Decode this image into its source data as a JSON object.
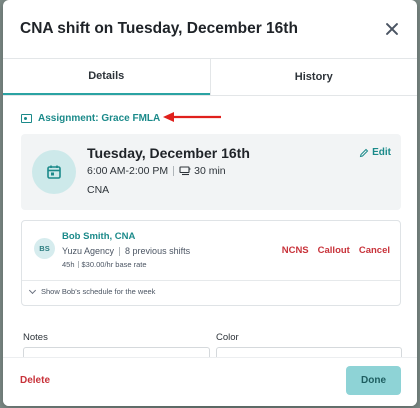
{
  "modal": {
    "title": "CNA shift on Tuesday, December 16th",
    "close_icon": "close-icon"
  },
  "tabs": [
    {
      "label": "Details",
      "active": true
    },
    {
      "label": "History",
      "active": false
    }
  ],
  "assignment": {
    "label": "Assignment: Grace FMLA",
    "icon": "calendar-user-icon"
  },
  "shift": {
    "date": "Tuesday, December 16th",
    "time": "6:00 AM-2:00 PM",
    "break": "30 min",
    "role": "CNA",
    "edit_label": "Edit"
  },
  "worker": {
    "initials": "BS",
    "name": "Bob Smith, CNA",
    "agency": "Yuzu Agency",
    "previous_shifts": "8 previous shifts",
    "hours": "45h",
    "rate": "$30.00/hr base rate",
    "actions": [
      "NCNS",
      "Callout",
      "Cancel"
    ],
    "schedule_toggle": "Show Bob's schedule for the week"
  },
  "form": {
    "notes_label": "Notes",
    "color_label": "Color"
  },
  "footer": {
    "delete_label": "Delete",
    "done_label": "Done"
  },
  "colors": {
    "accent": "#1b8a8a",
    "danger": "#c8323a",
    "arrow": "#e0201c",
    "done_button": "#8ed3d6"
  }
}
